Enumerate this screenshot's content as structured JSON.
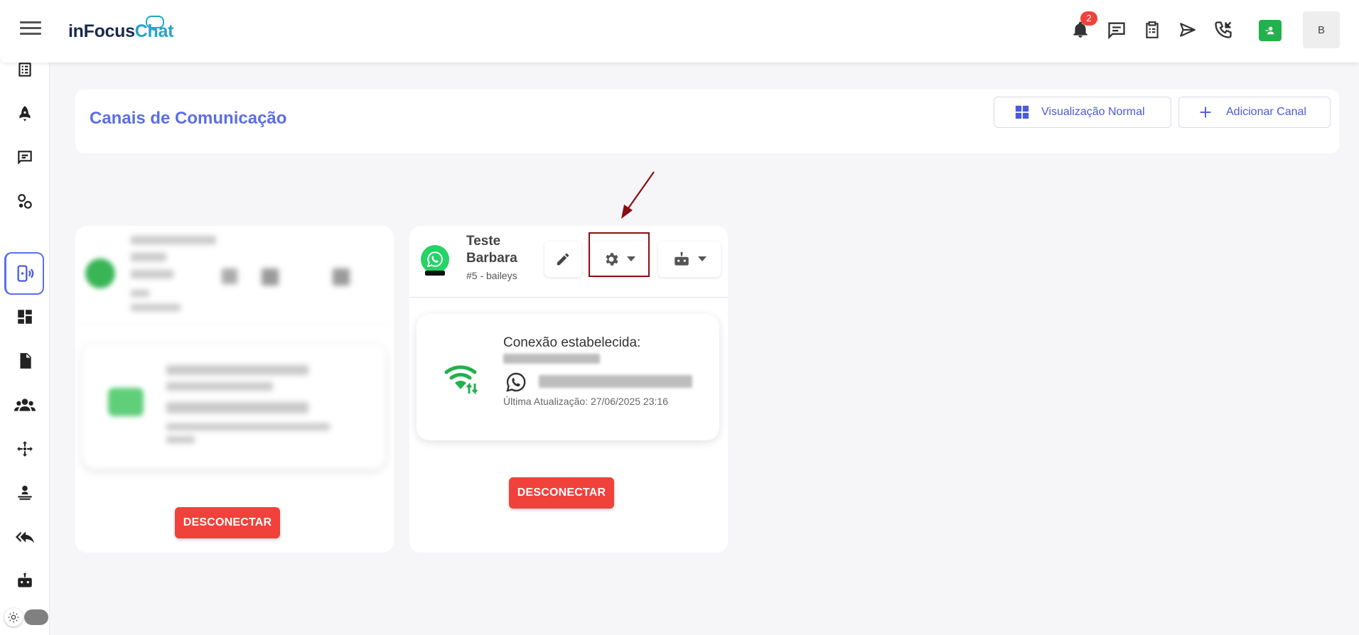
{
  "header": {
    "logo_part1": "inFocus",
    "logo_part2": "Chat",
    "notification_count": "2",
    "avatar_initial": "B"
  },
  "panel": {
    "title": "Canais de Comunicação",
    "view_button": "Visualização Normal",
    "add_button": "Adicionar Canal"
  },
  "channel_card": {
    "name": "Teste Barbara",
    "subtitle": "#5 - baileys",
    "connection_title": "Conexão estabelecida:",
    "last_update": "Última Atualização: 27/06/2025 23:16",
    "disconnect_label": "DESCONECTAR"
  },
  "blurred_card": {
    "disconnect_label": "DESCONECTAR"
  },
  "colors": {
    "accent": "#5b6ee6",
    "danger": "#f0413b",
    "success": "#22b14c",
    "highlight": "#8b0d12"
  }
}
